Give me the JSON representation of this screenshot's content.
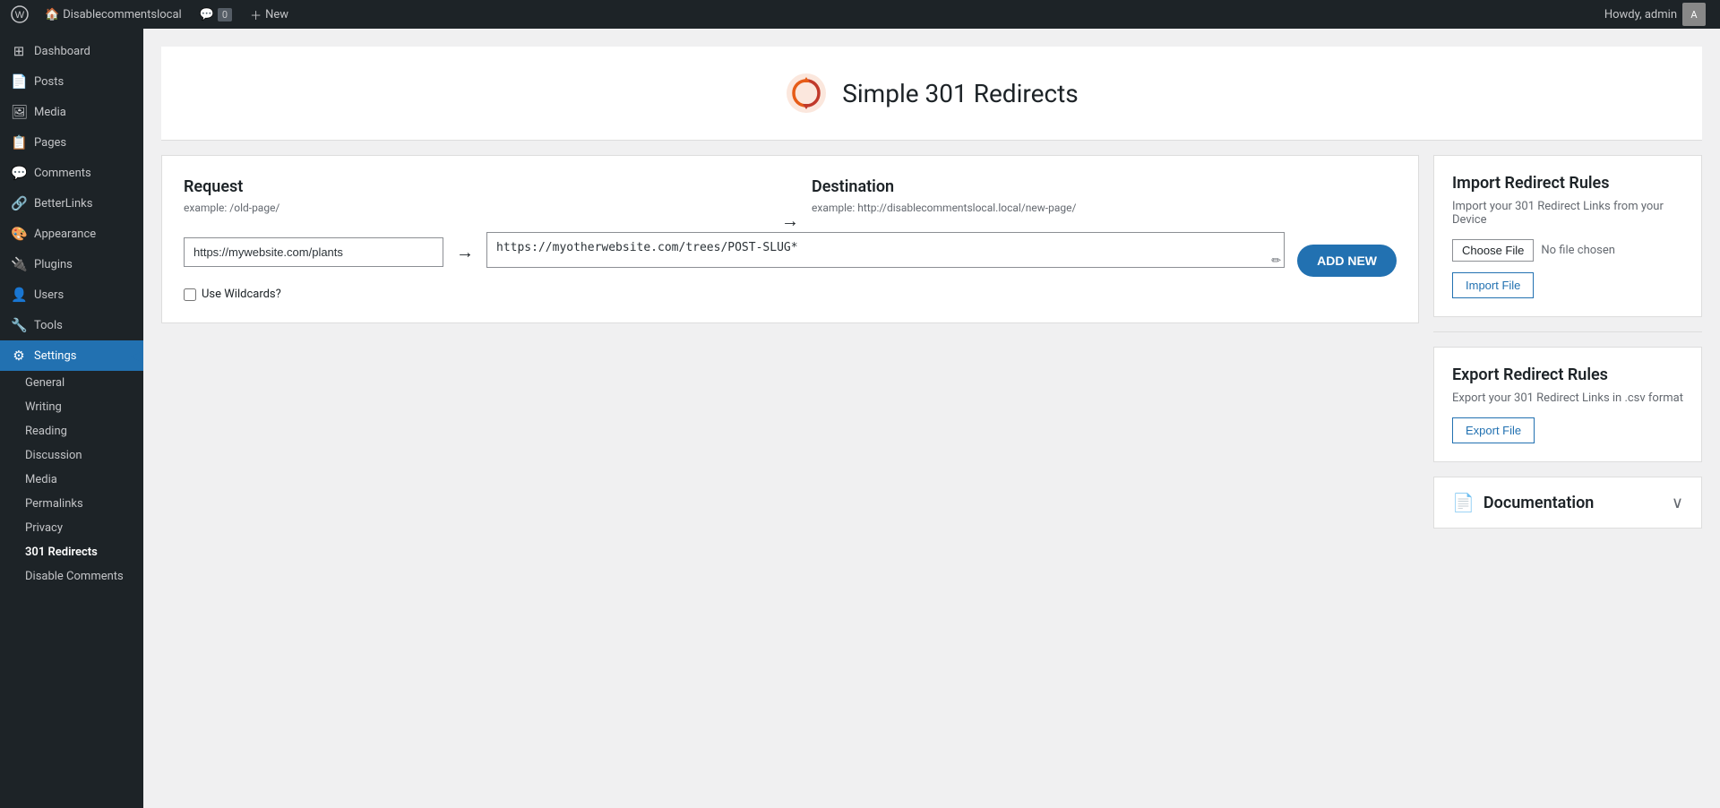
{
  "adminbar": {
    "logo": "W",
    "site_name": "Disablecommentslocal",
    "comments_count": "0",
    "new_label": "New",
    "howdy": "Howdy, admin"
  },
  "sidebar": {
    "items": [
      {
        "id": "dashboard",
        "label": "Dashboard",
        "icon": "⊞"
      },
      {
        "id": "posts",
        "label": "Posts",
        "icon": "📄"
      },
      {
        "id": "media",
        "label": "Media",
        "icon": "🖼"
      },
      {
        "id": "pages",
        "label": "Pages",
        "icon": "📋"
      },
      {
        "id": "comments",
        "label": "Comments",
        "icon": "💬"
      },
      {
        "id": "betterlinks",
        "label": "BetterLinks",
        "icon": "🔗"
      },
      {
        "id": "appearance",
        "label": "Appearance",
        "icon": "🎨"
      },
      {
        "id": "plugins",
        "label": "Plugins",
        "icon": "🔌"
      },
      {
        "id": "users",
        "label": "Users",
        "icon": "👤"
      },
      {
        "id": "tools",
        "label": "Tools",
        "icon": "🔧"
      },
      {
        "id": "settings",
        "label": "Settings",
        "icon": "⚙",
        "active": true
      }
    ],
    "settings_submenu": [
      {
        "id": "general",
        "label": "General"
      },
      {
        "id": "writing",
        "label": "Writing"
      },
      {
        "id": "reading",
        "label": "Reading"
      },
      {
        "id": "discussion",
        "label": "Discussion"
      },
      {
        "id": "media",
        "label": "Media"
      },
      {
        "id": "permalinks",
        "label": "Permalinks"
      },
      {
        "id": "privacy",
        "label": "Privacy"
      },
      {
        "id": "301redirects",
        "label": "301 Redirects",
        "active": true
      },
      {
        "id": "disablecomments",
        "label": "Disable Comments"
      }
    ]
  },
  "page": {
    "plugin_title": "Simple 301 Redirects",
    "request_label": "Request",
    "request_example": "example: /old-page/",
    "request_value": "https://mywebsite.com/plants",
    "destination_label": "Destination",
    "destination_example": "example: http://disablecommentslocal.local/new-page/",
    "destination_value": "https://myotherwebsite.com/trees/POST-SLUG*",
    "arrow": "→",
    "add_new_label": "ADD NEW",
    "wildcards_label": "Use Wildcards?",
    "import_section": {
      "title": "Import Redirect Rules",
      "description": "Import your 301 Redirect Links from your Device",
      "choose_file_label": "Choose File",
      "no_file_text": "No file chosen",
      "import_btn_label": "Import File"
    },
    "export_section": {
      "title": "Export Redirect Rules",
      "description": "Export your 301 Redirect Links in .csv format",
      "export_btn_label": "Export File"
    },
    "documentation": {
      "title": "Documentation",
      "chevron": "∨"
    }
  }
}
